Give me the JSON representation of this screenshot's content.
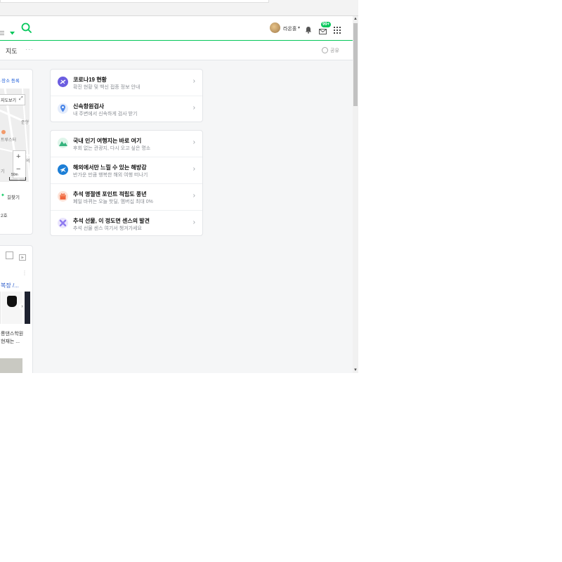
{
  "header": {
    "username": "라온홀",
    "mail_badge": "99+",
    "brand_color": "#03c75a"
  },
  "subnav": {
    "tab_map": "지도",
    "more": "···",
    "share": "공유"
  },
  "left_panel": {
    "register_link": "·장소 등록",
    "map_fullview": "지도보기",
    "map_labels": [
      "준형",
      "트루스터",
      "의",
      "기"
    ],
    "zoom_in": "+",
    "zoom_out": "−",
    "scale": "50m",
    "directions": "길찾기",
    "address_fragment": "2호"
  },
  "left_feed": {
    "title_fragment": "복장 /...",
    "caption_line1": "롱댄스학원",
    "caption_line2": "현재는 ..."
  },
  "cards": [
    {
      "rows": [
        {
          "title": "코로나19 현황",
          "subtitle": "확진 현황 및 백신 접종 정보 안내",
          "icon": "covid-icon",
          "color": "#6b5de0"
        },
        {
          "title": "신속항원검사",
          "subtitle": "내 주변에서 신속하게 검사 받기",
          "icon": "location-pin-icon",
          "color": "#4a86e8"
        }
      ]
    },
    {
      "rows": [
        {
          "title": "국내 인기 여행지는 바로 여기",
          "subtitle": "후회 없는 관광지, 다시 오고 싶은 명소",
          "icon": "mountain-icon",
          "color": "#36b37e"
        },
        {
          "title": "해외에서만 느낄 수 있는 해방감",
          "subtitle": "반가운 만큼 행복한 해외 여행 떠나기",
          "icon": "airplane-icon",
          "color": "#1c7ed6"
        },
        {
          "title": "추석 명절엔 포인트 적립도 풍년",
          "subtitle": "폐일 바뀌는 오늘 핫딜, 멤버십 최대 0%",
          "icon": "gift-icon",
          "color": "#f0643c"
        },
        {
          "title": "추석 선물, 이 정도면 센스의 발견",
          "subtitle": "추석 선물 센스 여기서 챙겨가세요",
          "icon": "ribbon-icon",
          "color": "#8f7bf0"
        }
      ]
    }
  ]
}
